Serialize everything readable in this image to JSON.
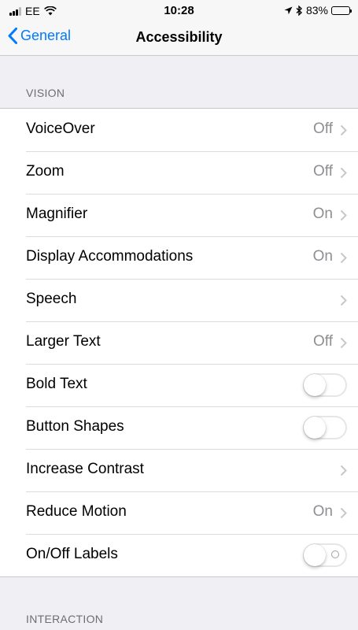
{
  "status_bar": {
    "carrier": "EE",
    "time": "10:28",
    "battery": "83%",
    "battery_level": 0.83
  },
  "nav": {
    "back_label": "General",
    "title": "Accessibility"
  },
  "sections": {
    "vision": {
      "header": "VISION",
      "rows": [
        {
          "label": "VoiceOver",
          "value": "Off",
          "control": "chevron"
        },
        {
          "label": "Zoom",
          "value": "Off",
          "control": "chevron"
        },
        {
          "label": "Magnifier",
          "value": "On",
          "control": "chevron"
        },
        {
          "label": "Display Accommodations",
          "value": "On",
          "control": "chevron"
        },
        {
          "label": "Speech",
          "value": "",
          "control": "chevron"
        },
        {
          "label": "Larger Text",
          "value": "Off",
          "control": "chevron"
        },
        {
          "label": "Bold Text",
          "control": "toggle",
          "on": false
        },
        {
          "label": "Button Shapes",
          "control": "toggle",
          "on": false
        },
        {
          "label": "Increase Contrast",
          "value": "",
          "control": "chevron"
        },
        {
          "label": "Reduce Motion",
          "value": "On",
          "control": "chevron"
        },
        {
          "label": "On/Off Labels",
          "control": "toggle",
          "on": false
        }
      ]
    },
    "interaction": {
      "header": "INTERACTION"
    }
  },
  "colors": {
    "accent": "#007aff",
    "background": "#efeff4",
    "secondary_text": "#8e8e93",
    "separator": "#c8c7cc"
  }
}
